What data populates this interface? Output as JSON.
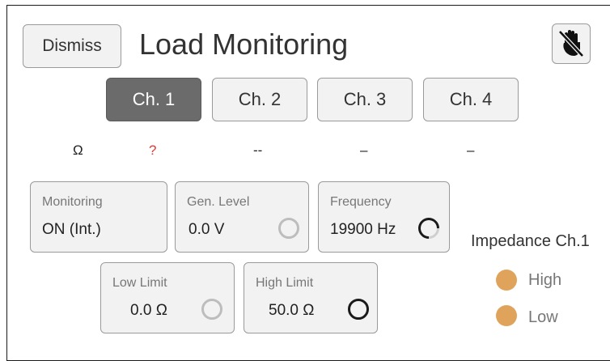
{
  "header": {
    "dismiss_label": "Dismiss",
    "title": "Load Monitoring",
    "mute_icon": "mute-hand-icon"
  },
  "tabs": [
    {
      "label": "Ch. 1",
      "active": true
    },
    {
      "label": "Ch. 2",
      "active": false
    },
    {
      "label": "Ch. 3",
      "active": false
    },
    {
      "label": "Ch. 4",
      "active": false
    }
  ],
  "ohm_row": {
    "symbol": "Ω",
    "ch1": "?",
    "ch2": "--",
    "ch3": "–",
    "ch4": "–"
  },
  "fields": {
    "monitoring": {
      "label": "Monitoring",
      "value": "ON (Int.)"
    },
    "gen_level": {
      "label": "Gen. Level",
      "value": "0.0 V"
    },
    "frequency": {
      "label": "Frequency",
      "value": "19900 Hz"
    },
    "low_limit": {
      "label": "Low Limit",
      "value": "0.0 Ω"
    },
    "high_limit": {
      "label": "High Limit",
      "value": "50.0 Ω"
    }
  },
  "impedance": {
    "title": "Impedance Ch.1",
    "high_label": "High",
    "low_label": "Low"
  },
  "colors": {
    "active_tab": "#6b6b6b",
    "warning": "#e53935",
    "indicator": "#e0a35b"
  }
}
